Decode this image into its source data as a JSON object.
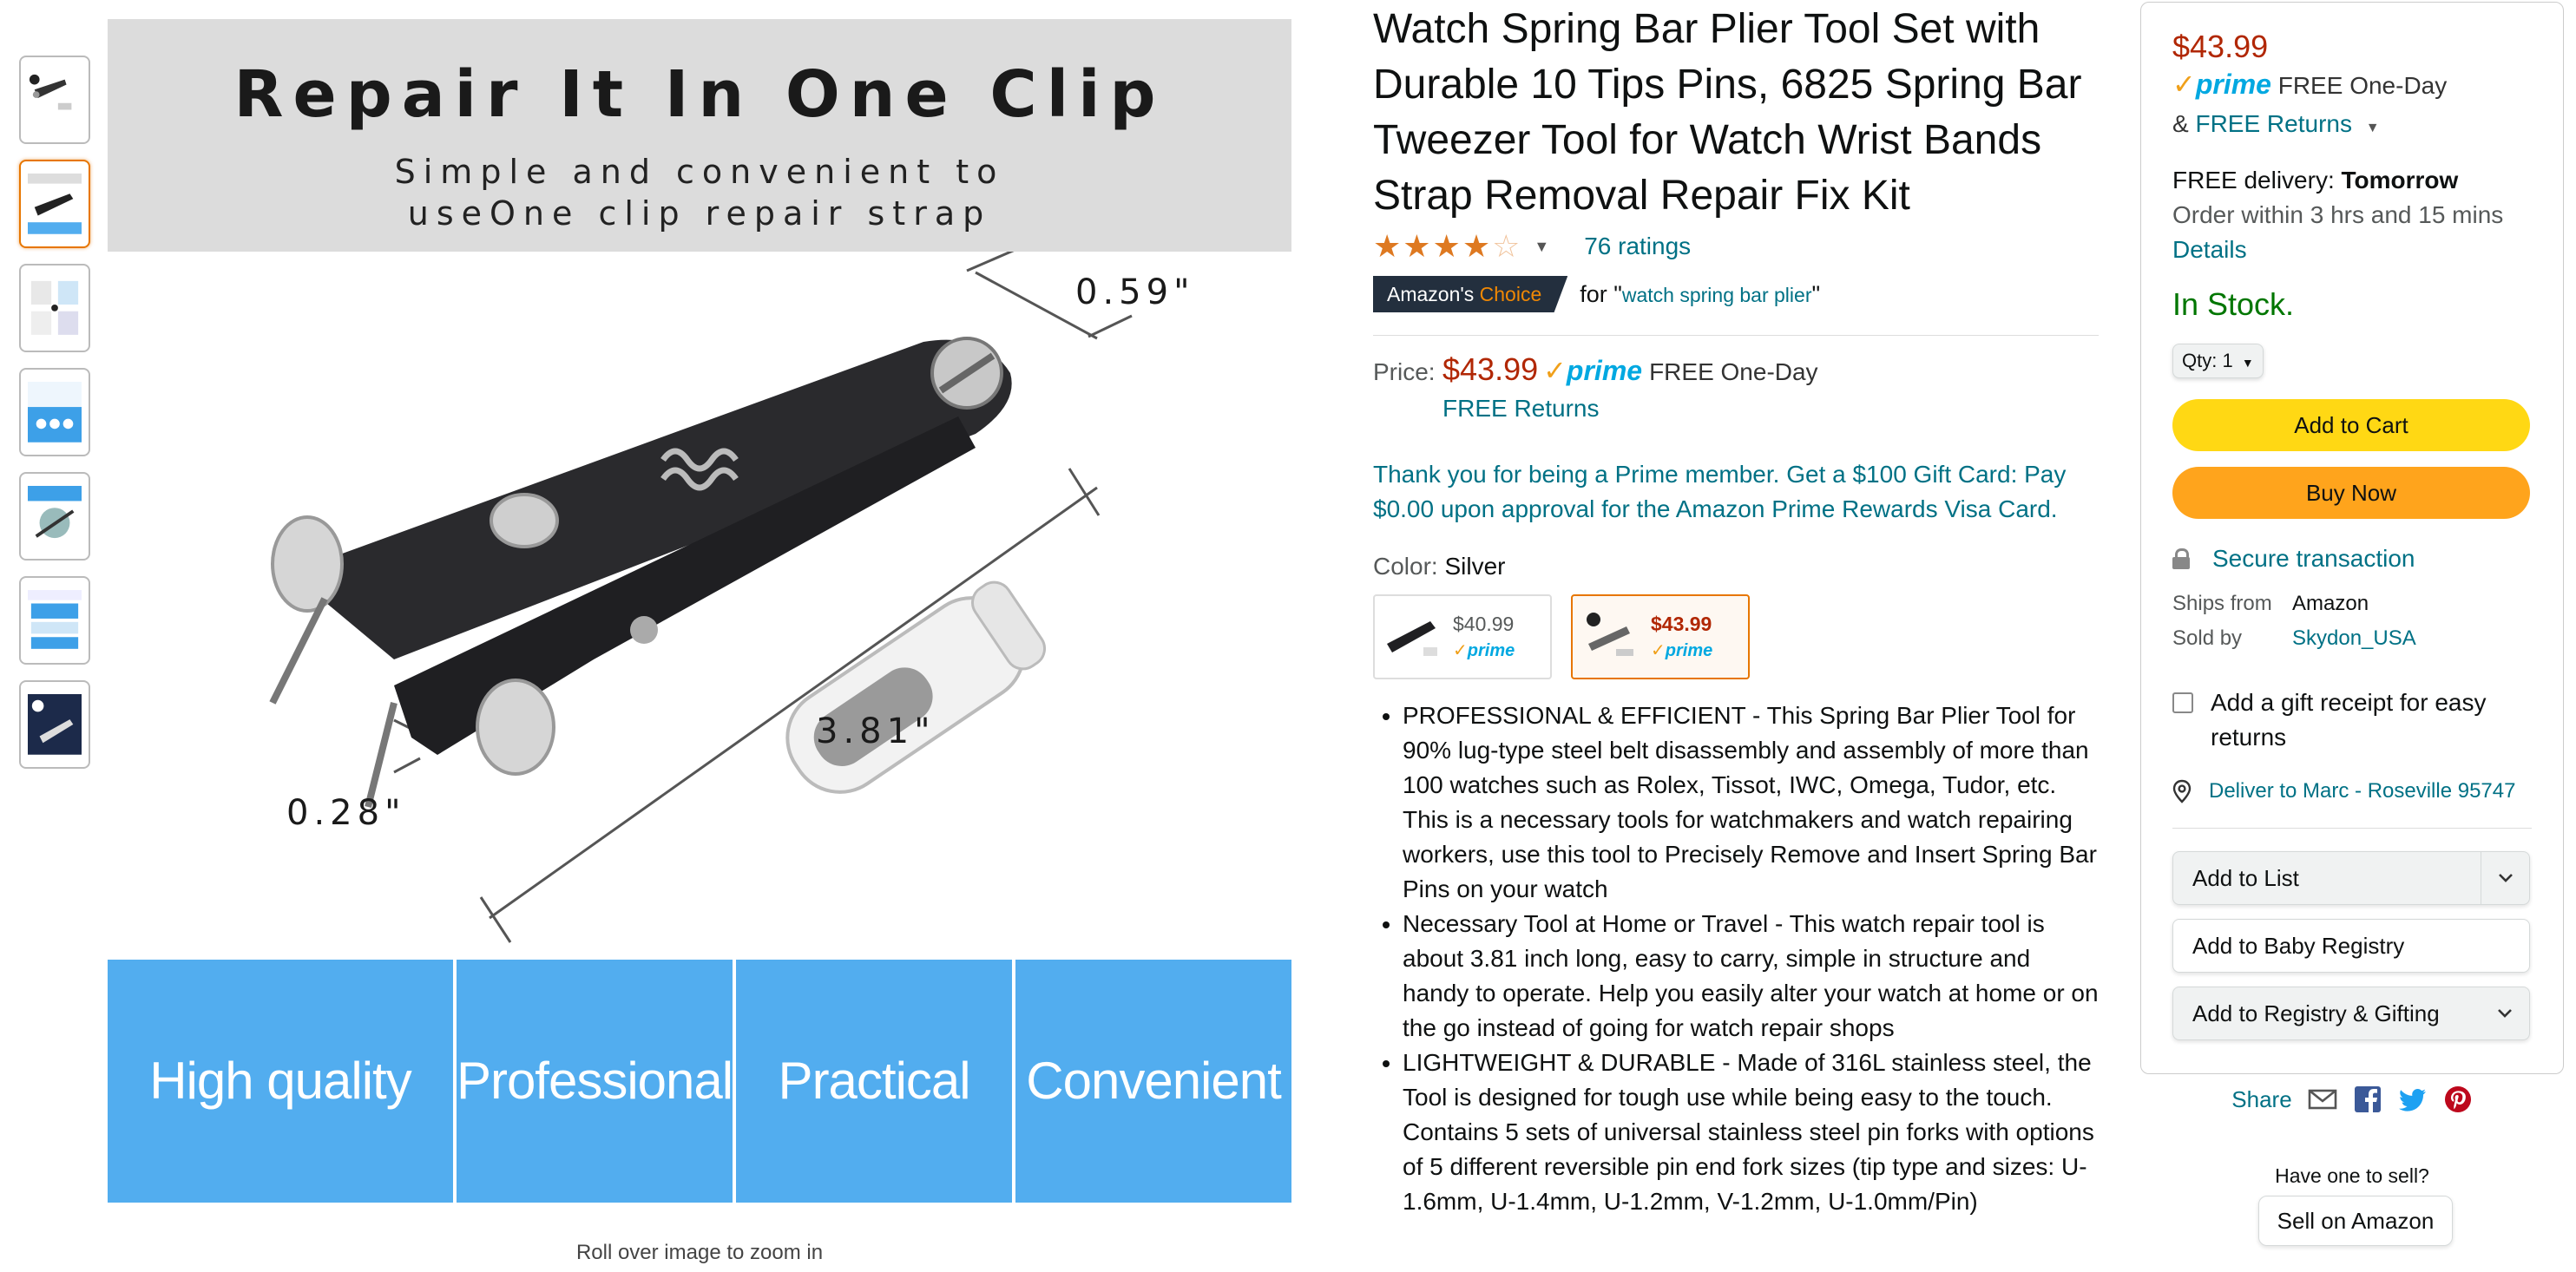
{
  "gallery": {
    "thumbnail_count": 7,
    "selected_index": 1,
    "image": {
      "title": "Repair It In One Clip",
      "subtitle_line1": "Simple and convenient to",
      "subtitle_line2": "useOne clip repair strap",
      "dim_top": "0.59\"",
      "dim_long": "3.81\"",
      "dim_left": "0.28\"",
      "tiles": [
        "High quality",
        "Professional",
        "Practical",
        "Convenient"
      ]
    },
    "zoom_hint": "Roll over image to zoom in"
  },
  "product": {
    "title": "Watch Spring Bar Plier Tool Set with Durable 10 Tips Pins, 6825 Spring Bar Tweezer Tool for Watch Wrist Bands Strap Removal Repair Fix Kit",
    "rating_stars": 4,
    "rating_count": "76 ratings",
    "badge_prefix": "Amazon's",
    "badge_suffix": "Choice",
    "badge_for_prefix": "for \"",
    "badge_keyword": "watch spring bar plier",
    "badge_for_suffix": "\"",
    "price_label": "Price:",
    "price": "$43.99",
    "prime_label": "prime",
    "prime_delivery": "FREE One-Day",
    "free_returns": "FREE Returns",
    "prime_member_msg": "Thank you for being a Prime member. Get a $100 Gift Card: Pay $0.00 upon approval for the Amazon Prime Rewards Visa Card.",
    "color_label": "Color:",
    "color_value": "Silver",
    "swatches": [
      {
        "price": "$40.99",
        "prime": "prime"
      },
      {
        "price": "$43.99",
        "prime": "prime"
      }
    ],
    "bullets": [
      "PROFESSIONAL & EFFICIENT - This Spring Bar Plier Tool for 90% lug-type steel belt disassembly and assembly of more than 100 watches such as Rolex, Tissot, IWC, Omega, Tudor, etc. This is a necessary tools for watchmakers and watch repairing workers, use this tool to Precisely Remove and Insert Spring Bar Pins on your watch",
      "Necessary Tool at Home or Travel - This watch repair tool is about 3.81 inch long, easy to carry, simple in structure and handy to operate. Help you easily alter your watch at home or on the go instead of going for watch repair shops",
      "LIGHTWEIGHT & DURABLE - Made of 316L stainless steel, the Tool is designed for tough use while being easy to the touch. Contains 5 sets of universal stainless steel pin forks with options of 5 different reversible pin end fork sizes (tip type and sizes: U-1.6mm, U-1.4mm, U-1.2mm, V-1.2mm, U-1.0mm/Pin)"
    ]
  },
  "buybox": {
    "price": "$43.99",
    "prime_label": "prime",
    "prime_delivery": "FREE One-Day",
    "amp": "&",
    "free_returns": "FREE Returns",
    "delivery_prefix": "FREE delivery:",
    "delivery_day": "Tomorrow",
    "order_within": "Order within 3 hrs and 15 mins",
    "details_link": "Details",
    "stock": "In Stock.",
    "qty_label": "Qty:",
    "qty_value": "1",
    "add_to_cart": "Add to Cart",
    "buy_now": "Buy Now",
    "secure": "Secure transaction",
    "ships_from_label": "Ships from",
    "ships_from_value": "Amazon",
    "sold_by_label": "Sold by",
    "sold_by_value": "Skydon_USA",
    "gift_receipt": "Add a gift receipt for easy returns",
    "deliver_to": "Deliver to Marc - Roseville 95747",
    "add_to_list": "Add to List",
    "add_to_baby": "Add to Baby Registry",
    "add_to_registry": "Add to Registry & Gifting"
  },
  "share": {
    "label": "Share"
  },
  "sell": {
    "question": "Have one to sell?",
    "button": "Sell on Amazon"
  },
  "colors": {
    "link": "#007185",
    "price": "#b12704",
    "prime": "#00a8e1",
    "stock": "#007600",
    "cart_button": "#ffd814",
    "buy_button": "#ffa41c",
    "tile_blue": "#52adef"
  }
}
